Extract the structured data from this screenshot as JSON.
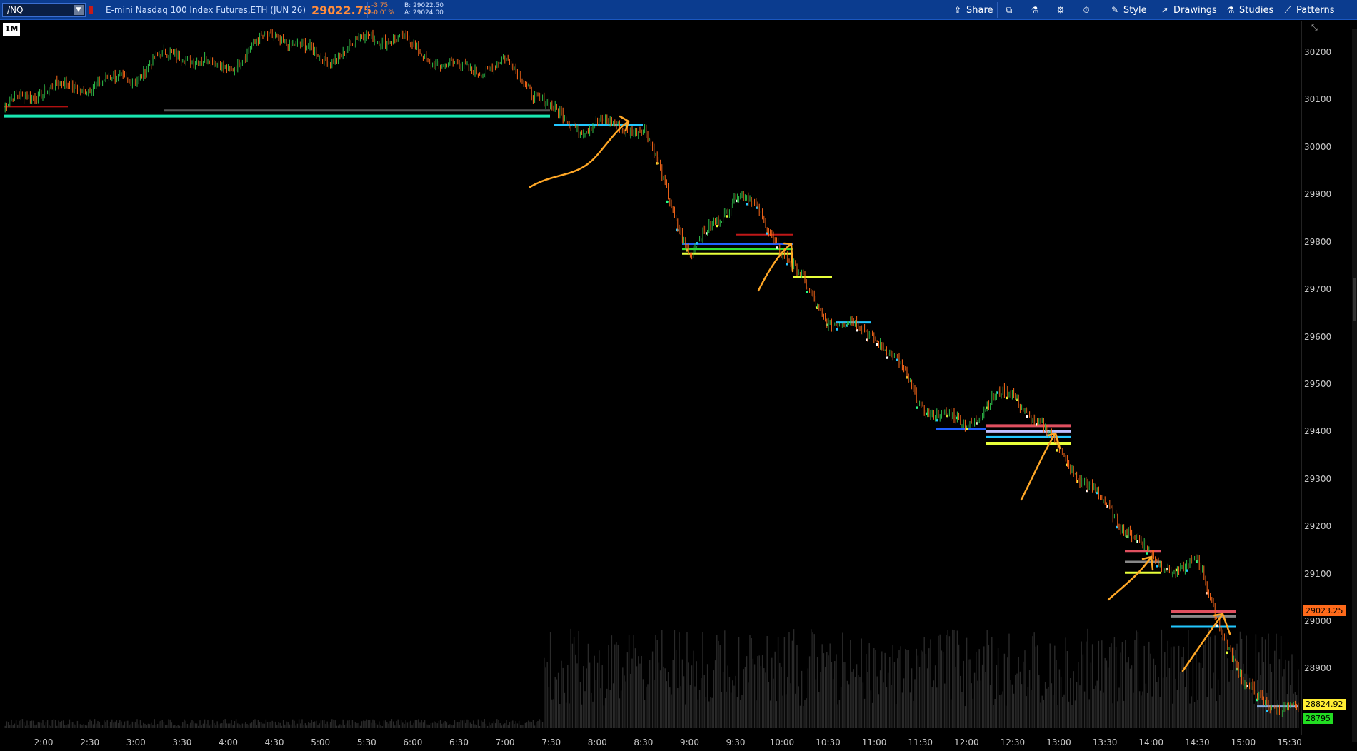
{
  "toolbar": {
    "symbol": "/NQ",
    "instrument": "E-mini Nasdaq 100 Index Futures,ETH (JUN 26)",
    "last_price": "29022.75",
    "change": "-3.75",
    "change_pct": "-0.01%",
    "bid": "B: 29022.50",
    "ask": "A: 29024.00",
    "buttons": {
      "share": "Share",
      "style": "Style",
      "drawings": "Drawings",
      "studies": "Studies",
      "patterns": "Patterns"
    }
  },
  "chart": {
    "timeframe": "1M",
    "price_labels": [
      "30200",
      "30100",
      "30000",
      "29900",
      "29800",
      "29700",
      "29600",
      "29500",
      "29400",
      "29300",
      "29200",
      "29100",
      "29000",
      "28900"
    ],
    "time_labels": [
      "2:00",
      "2:30",
      "3:00",
      "3:30",
      "4:00",
      "4:30",
      "5:00",
      "5:30",
      "6:00",
      "6:30",
      "7:00",
      "7:30",
      "8:00",
      "8:30",
      "9:00",
      "9:30",
      "10:00",
      "10:30",
      "11:00",
      "11:30",
      "12:00",
      "12:30",
      "13:00",
      "13:30",
      "14:00",
      "14:30",
      "15:00",
      "15:30"
    ],
    "tags": {
      "last": "29023.25",
      "level_yellow": "28824.92",
      "level_green": "28795"
    }
  },
  "chart_data": {
    "type": "line",
    "x": [
      "2:00",
      "2:30",
      "3:00",
      "3:30",
      "4:00",
      "4:30",
      "5:00",
      "5:30",
      "6:00",
      "6:30",
      "7:00",
      "7:30",
      "8:00",
      "8:30",
      "9:00",
      "9:30",
      "10:00",
      "10:30",
      "11:00",
      "11:30",
      "12:00",
      "12:30",
      "13:00",
      "13:30",
      "14:00",
      "14:30",
      "15:00",
      "15:30"
    ],
    "values": [
      30110,
      30150,
      30140,
      30200,
      30180,
      30220,
      30200,
      30230,
      30200,
      30180,
      30160,
      30080,
      30050,
      30020,
      29790,
      29900,
      29780,
      29650,
      29590,
      29470,
      29420,
      29470,
      29380,
      29230,
      29130,
      29130,
      28840,
      28820
    ],
    "ylim": [
      28780,
      30260
    ]
  },
  "colors": {
    "up_candle": "#2fbf4a",
    "down_candle": "#ff6a1a",
    "annotation": "#ffa726",
    "tag_last": "#ff6a1a",
    "tag_yellow": "#ffee33",
    "tag_green": "#22dd22",
    "toolbar_bg": "#0b3c8f"
  }
}
